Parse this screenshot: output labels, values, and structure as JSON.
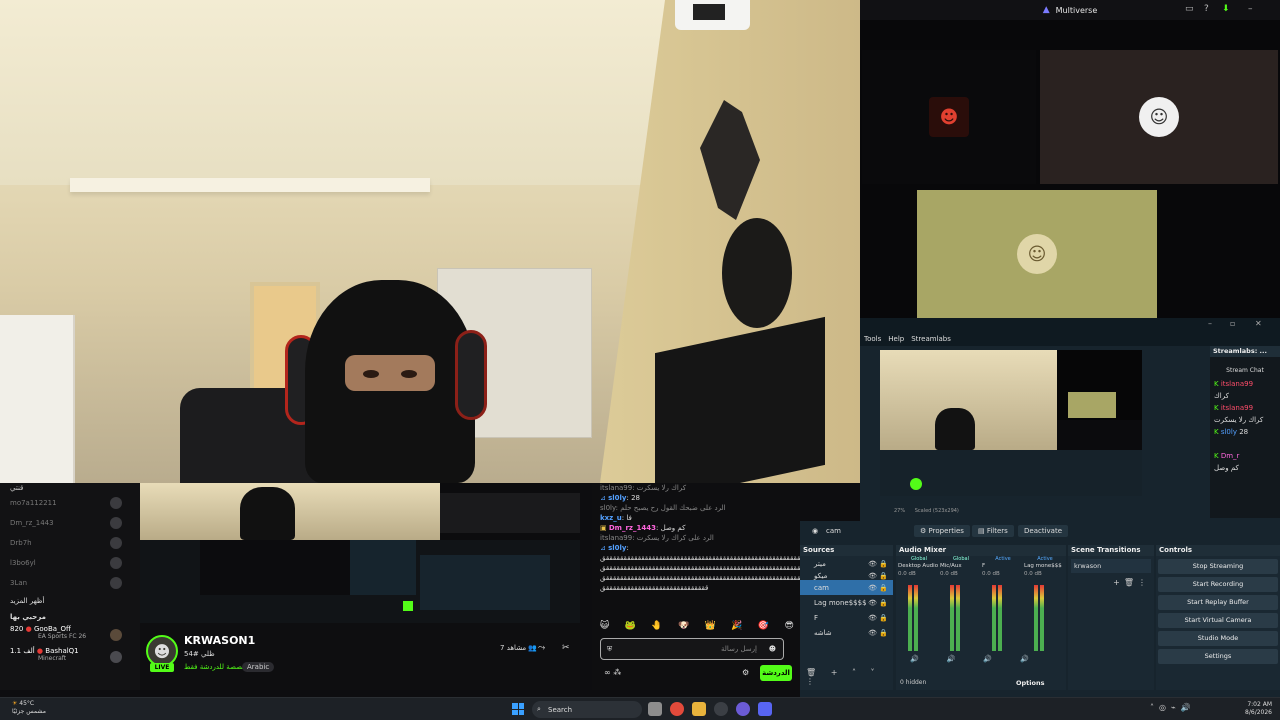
{
  "multiverse": {
    "title": "Multiverse"
  },
  "streamlabs": {
    "menu": [
      "Tools",
      "Help",
      "Streamlabs"
    ],
    "chat_panel_title": "Streamlabs: ...",
    "chat_title": "Stream Chat",
    "chat": [
      {
        "user": "itslana99",
        "text": ""
      },
      {
        "user": "",
        "text": "كراك"
      },
      {
        "user": "itslana99",
        "text": ""
      },
      {
        "user": "",
        "text": "كراك رلا يسكرت"
      },
      {
        "user": "sl0ly",
        "text": "28"
      },
      {
        "user": "Dm_r",
        "text": ""
      },
      {
        "user": "",
        "text": "كم وصل"
      }
    ],
    "zoom": "27%",
    "scaled": "Scaled (523x294)",
    "cam_label": "cam",
    "properties_label": "Properties",
    "filters_label": "Filters",
    "deactivate_label": "Deactivate",
    "sources": {
      "title": "Sources",
      "items": [
        "ميتر",
        "ميكو",
        "cam",
        "Lag mone$$$$",
        "F",
        "شاشه"
      ]
    },
    "audio_mixer": {
      "title": "Audio Mixer",
      "columns": [
        {
          "scope": "Global",
          "name": "Desktop Audio",
          "db": "0.0 dB"
        },
        {
          "scope": "Global",
          "name": "Mic/Aux",
          "db": "0.0 dB"
        },
        {
          "scope": "Active",
          "name": "F",
          "db": "0.0 dB"
        },
        {
          "scope": "Active",
          "name": "Lag mone$$$",
          "db": "0.0 dB"
        }
      ],
      "hidden_label": "0 hidden",
      "options_label": "Options"
    },
    "scene_transitions": {
      "title": "Scene Transitions",
      "value": "krwason"
    },
    "controls": {
      "title": "Controls",
      "buttons": [
        "Stop Streaming",
        "Start Recording",
        "Start Replay Buffer",
        "Start Virtual Camera",
        "Studio Mode",
        "Settings"
      ]
    }
  },
  "sidebar": {
    "header": "قنتي",
    "followed": [
      "mo7a112211",
      "Dm_rz_1443",
      "Drb7h",
      "l3bo6yl",
      "3Lan"
    ],
    "show_more": "أظهر المزيد",
    "recommended_header": "مرحبي بها",
    "recommended": [
      {
        "viewers": "820",
        "name": "GooBa_Off",
        "game": "EA Sports FC 26"
      },
      {
        "viewers": "1.1 ألف",
        "name": "BashalQ1",
        "game": "Minecraft"
      }
    ]
  },
  "stream": {
    "name": "KRWASON1",
    "title": "ظلي #54",
    "category": "مخصصة للدردشة فقط",
    "language": "Arabic",
    "viewers": "مشاهد 7",
    "live": "LIVE"
  },
  "chat": {
    "messages": [
      {
        "user": "",
        "text": "itslana99: كراك رلا يسكرت"
      },
      {
        "user": "sl0ly",
        "text": ": 28"
      },
      {
        "user": "",
        "text": "sl0ly: الرد على ضبحك القول رح يصبح حلم"
      },
      {
        "user": "kxz_u",
        "text": ": فا"
      },
      {
        "user": "Dm_rz_1443",
        "text": ": كم وصل"
      },
      {
        "user": "",
        "text": "itslana99: الرد على كراك رلا يسكرت"
      },
      {
        "user": "sl0ly",
        "text": ":"
      },
      {
        "user": "",
        "text": "ققققققققققققققققققققققققققققققققققققققققققققققققققققققققققققق"
      },
      {
        "user": "",
        "text": "ققققققققققققققققققققققققققققققققققققققققققققققققققققققققققققق"
      },
      {
        "user": "",
        "text": "قققققققققققققققققققققققققققققققققققققققققققققققققققققققققققققق"
      },
      {
        "user": "",
        "text": "قققققققققققققققققققققققققققققق"
      }
    ],
    "placeholder": "إرسل رسالة",
    "send_label": "الدردشة"
  },
  "taskbar": {
    "temp": "45°C",
    "weather_text": "مشمس جزئيًا",
    "search": "Search",
    "time": "7:02 AM",
    "date": "8/6/2026"
  },
  "colors": {
    "kick_green": "#53fc18",
    "obs_panel": "#17242d",
    "accent_blue": "#3aa0ff"
  }
}
